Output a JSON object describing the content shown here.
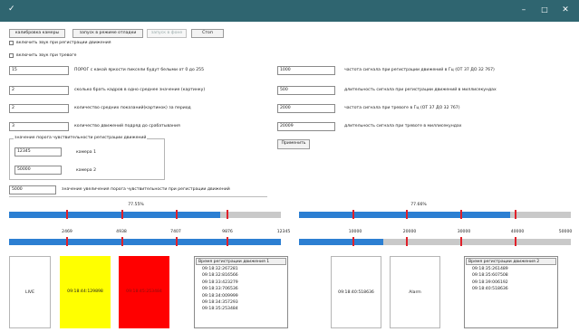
{
  "window": {
    "title": ""
  },
  "toolbar": {
    "calibrate": "калибровка камеры",
    "debug": "запуск в режиме отладки",
    "background": "запуск в фоне",
    "stop": "Стоп"
  },
  "checks": {
    "sound_motion": "включить звук при регистрации движения",
    "sound_alarm": "включить звук при тревоге"
  },
  "left_params": [
    {
      "value": "15",
      "label": "ПОРОГ с какой яркости пиксели будут белыми от 0 до 255"
    },
    {
      "value": "2",
      "label": "сколько брать кадров в одно среднее значение (картинку)"
    },
    {
      "value": "2",
      "label": "количество средних показаний(картинок) за период"
    },
    {
      "value": "3",
      "label": "количество движений подряд до срабатывания"
    }
  ],
  "right_params": [
    {
      "value": "1000",
      "label": "частота сигнала при регистрации движений в Гц (ОТ 37 ДО 32 767)"
    },
    {
      "value": "500",
      "label": "длительность сигнала при регистрации движений в миллисекундах"
    },
    {
      "value": "2000",
      "label": "частота сигнала при тревоге в Гц (ОТ 37 ДО 32 767)"
    },
    {
      "value": "20009",
      "label": "длительность сигнала при тревоге в миллисекундах"
    }
  ],
  "apply_label": "Применить",
  "threshold_group": {
    "legend": "значение порога чувствительности регистрации движений",
    "cam1_value": "12345",
    "cam1_label": "камера 1",
    "cam2_value": "50000",
    "cam2_label": "камера 2"
  },
  "increase": {
    "value": "5000",
    "label": "значение увеличения порога чувствительности при регистрации движений"
  },
  "cam1": {
    "percent": "77.55%",
    "bar_top_fill": 0.7755,
    "bar_bottom_fill": 1.0,
    "ticks": [
      "2469",
      "4938",
      "7407",
      "9876",
      "12345"
    ],
    "status_live": "LIVE",
    "yellow_time": "09:18:44:129898",
    "red_time": "09:18:45:253484",
    "list_header": "Время регистрации движения 1",
    "list": [
      "09:18:32:267281",
      "09:18:32:816566",
      "09:18:33:423279",
      "09:18:33:706536",
      "09:18:34:009999",
      "09:18:34:357293",
      "09:18:35:253484"
    ]
  },
  "cam2": {
    "percent": "77.66%",
    "bar_top_fill": 0.7766,
    "bar_bottom_fill": 0.31,
    "ticks": [
      "10000",
      "20000",
      "30000",
      "40000",
      "50000"
    ],
    "status_time": "09:18:40:518636",
    "alarm_label": "Alarm",
    "list_header": "Время регистрации движения 2",
    "list": [
      "09:18:35:261489",
      "09:18:35:607508",
      "09:18:39:006192",
      "09:18:40:518636"
    ]
  },
  "colors": {
    "titlebar": "#2f6570",
    "bar_fill": "#2c7fd2",
    "marker": "#e0202a",
    "yellow": "#ffff00",
    "red": "#ff0000"
  }
}
